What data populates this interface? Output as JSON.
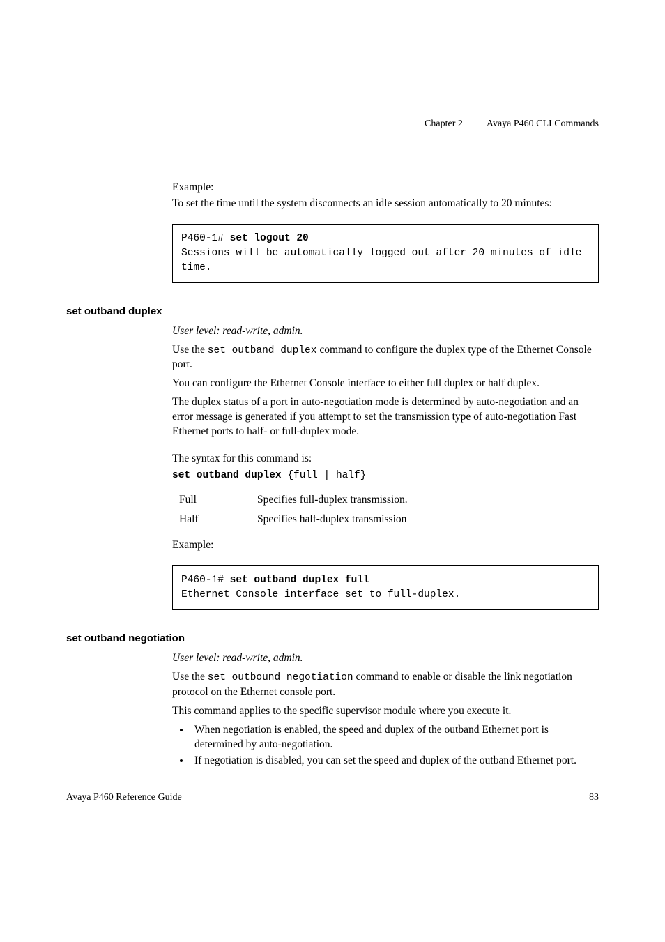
{
  "header": {
    "chapter": "Chapter 2",
    "title": "Avaya P460 CLI Commands"
  },
  "example1": {
    "label": "Example:",
    "desc": "To set the time until the system disconnects an idle session automatically to 20 minutes:",
    "code_prompt": "P460-1# ",
    "code_cmd": "set logout 20",
    "code_output": "Sessions will be automatically logged out after 20 minutes of idle time."
  },
  "section1": {
    "heading": "set outband duplex",
    "userlevel": "User level: read-write, admin.",
    "para1a": "Use the ",
    "para1_code": "set outband duplex",
    "para1b": " command to configure the duplex type of the Ethernet Console port.",
    "para2": "You can configure the Ethernet Console interface to either full duplex or half duplex.",
    "para3": "The duplex status of a port in auto-negotiation mode is determined by auto-negotiation and an error message is generated if you attempt to set the transmission type of auto-negotiation Fast Ethernet ports to half- or full-duplex mode.",
    "syntax_label": "The syntax for this command is:",
    "syntax_cmd_bold": "set outband duplex ",
    "syntax_cmd_rest": "{full | half}",
    "params": [
      {
        "name": "Full",
        "desc": "Specifies full-duplex transmission."
      },
      {
        "name": "Half",
        "desc": "Specifies half-duplex transmission"
      }
    ],
    "example_label": "Example:",
    "example_prompt": "P460-1# ",
    "example_cmd": "set outband duplex full",
    "example_output": "Ethernet Console interface set to full-duplex."
  },
  "section2": {
    "heading": "set outband negotiation",
    "userlevel": "User level: read-write, admin.",
    "para1a": "Use the ",
    "para1_code": "set outbound negotiation",
    "para1b": " command to enable or disable the link negotiation protocol on the Ethernet console port.",
    "para2": "This command applies to the specific supervisor module where you execute it.",
    "bullets": [
      "When negotiation is enabled, the speed and duplex of the outband Ethernet port is determined by auto-negotiation.",
      "If negotiation is disabled, you can set the speed and duplex of the outband Ethernet port."
    ]
  },
  "footer": {
    "left": "Avaya P460 Reference Guide",
    "right": "83"
  }
}
